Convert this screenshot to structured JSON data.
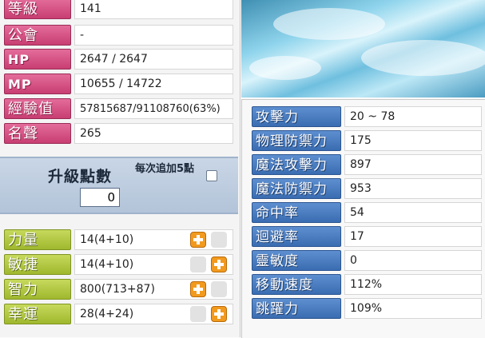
{
  "profile": {
    "rows": [
      {
        "label": "等級",
        "value": "141"
      },
      {
        "label": "公會",
        "value": "-"
      },
      {
        "label": "HP",
        "value": "2647 / 2647"
      },
      {
        "label": "MP",
        "value": "10655 / 14722"
      },
      {
        "label": "經驗值",
        "value": "57815687/91108760(63%)"
      },
      {
        "label": "名聲",
        "value": "265"
      }
    ]
  },
  "level_up": {
    "title": "升級點數",
    "points": "0",
    "auto_add_label": "每次追加5點",
    "auto_add_checked": false
  },
  "abilities": [
    {
      "label": "力量",
      "value": "14(4+10)",
      "up_icon": "plus-icon-left"
    },
    {
      "label": "敏捷",
      "value": "14(4+10)",
      "up_icon": "plus-icon-right"
    },
    {
      "label": "智力",
      "value": "800(713+87)",
      "up_icon": "plus-icon-left"
    },
    {
      "label": "幸運",
      "value": "28(4+24)",
      "up_icon": "plus-icon-right"
    }
  ],
  "combat": [
    {
      "label": "攻擊力",
      "value": "20 ~ 78"
    },
    {
      "label": "物理防禦力",
      "value": "175"
    },
    {
      "label": "魔法攻擊力",
      "value": "897"
    },
    {
      "label": "魔法防禦力",
      "value": "953"
    },
    {
      "label": "命中率",
      "value": "54"
    },
    {
      "label": "迴避率",
      "value": "17"
    },
    {
      "label": "靈敏度",
      "value": "0"
    },
    {
      "label": "移動速度",
      "value": "112%"
    },
    {
      "label": "跳躍力",
      "value": "109%"
    }
  ],
  "colors": {
    "profile_label": "#d34f84",
    "ability_label": "#b2c943",
    "combat_label": "#4a7dc1",
    "plus_button": "#f29a1e"
  }
}
